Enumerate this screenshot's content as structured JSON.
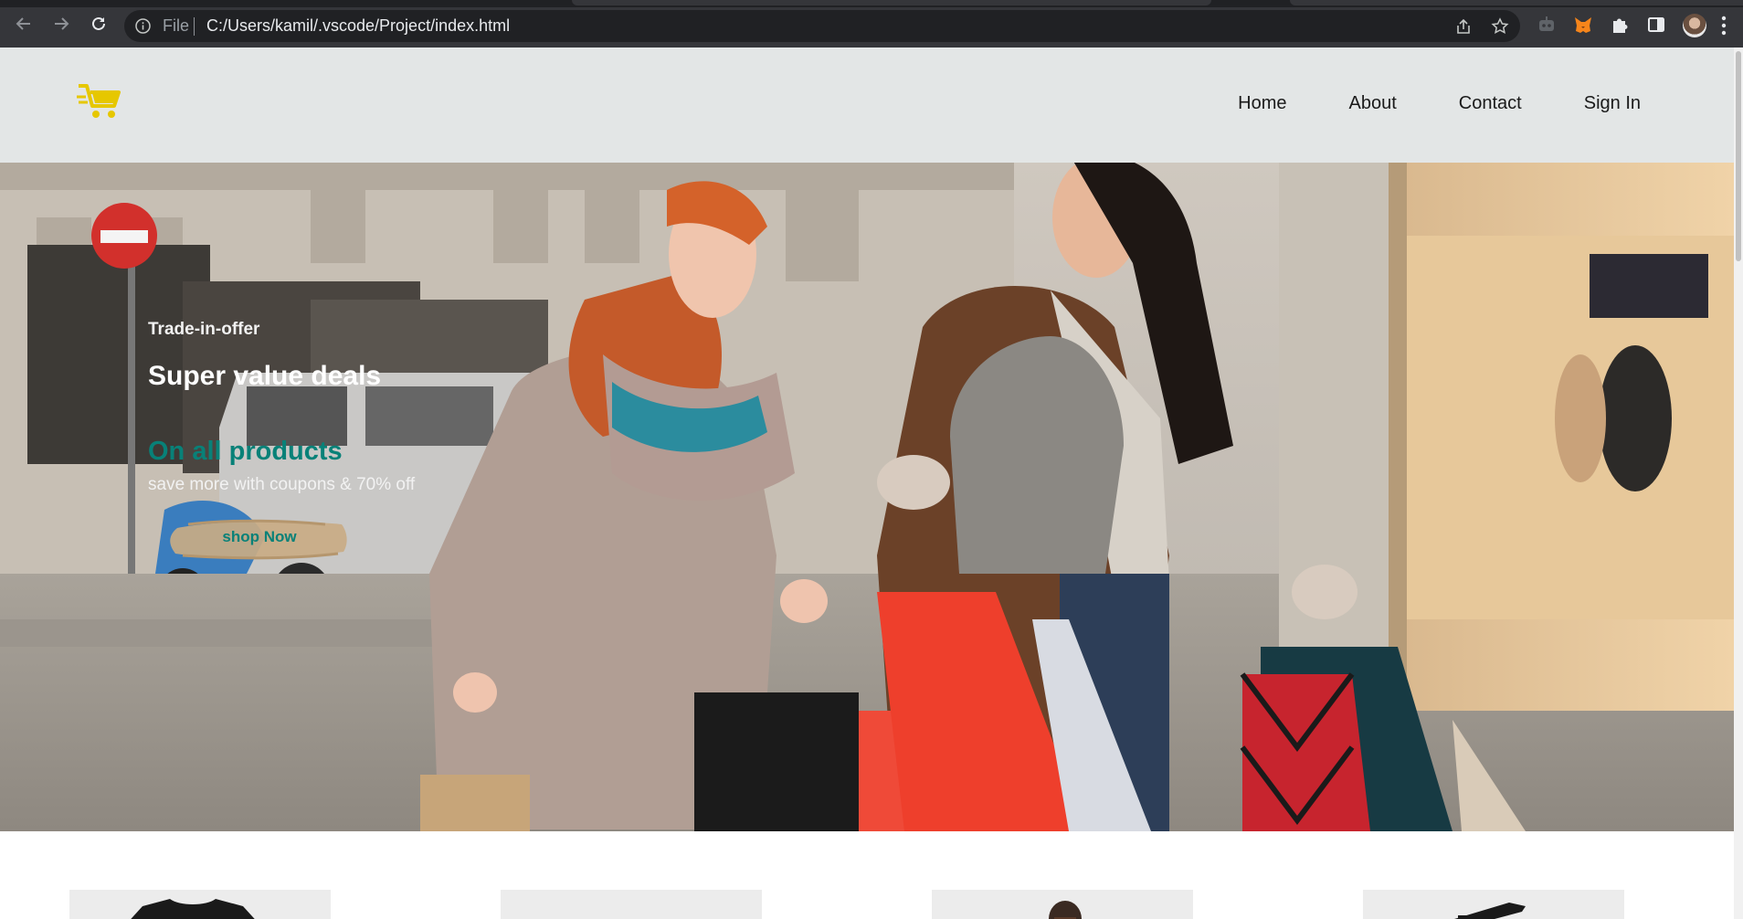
{
  "browser": {
    "url_scheme": "File",
    "url": "C:/Users/kamil/.vscode/Project/index.html",
    "icons": [
      "back-icon",
      "forward-icon",
      "reload-icon",
      "info-icon",
      "share-icon",
      "star-icon",
      "robot-extension-icon",
      "fox-extension-icon",
      "puzzle-icon",
      "side-panel-icon",
      "profile-avatar",
      "kebab-menu-icon"
    ]
  },
  "site": {
    "logo_icon": "cart-icon",
    "logo_color": "#e6c700",
    "header_bg": "#e3e6e6",
    "nav": [
      {
        "label": "Home"
      },
      {
        "label": "About"
      },
      {
        "label": "Contact"
      },
      {
        "label": "Sign In"
      }
    ]
  },
  "hero": {
    "kicker": "Trade-in-offer",
    "headline": "Super value deals",
    "tagline": "On all products",
    "subtext": "save more with coupons & 70% off",
    "button_label": "shop Now",
    "accent_color": "#088178"
  },
  "features": {
    "tiles": [
      "t-shirt",
      "blank",
      "person",
      "gadget"
    ]
  }
}
